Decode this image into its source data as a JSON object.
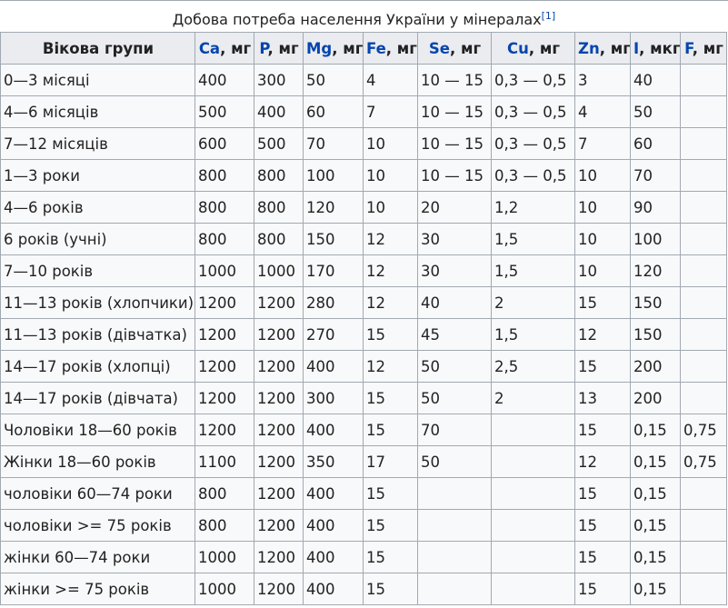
{
  "caption": {
    "text": "Добова потреба населення України у мінералах",
    "ref": "[1]"
  },
  "headers": [
    {
      "name": "Вікова групи",
      "link": false
    },
    {
      "name": "Ca",
      "unit": ", мг",
      "link": true
    },
    {
      "name": "P",
      "unit": ", мг",
      "link": true
    },
    {
      "name": "Mg",
      "unit": ", мг",
      "link": true
    },
    {
      "name": "Fe",
      "unit": ", мг",
      "link": true
    },
    {
      "name": "Se",
      "unit": ", мг",
      "link": true
    },
    {
      "name": "Cu",
      "unit": ", мг",
      "link": true
    },
    {
      "name": "Zn",
      "unit": ", мг",
      "link": true
    },
    {
      "name": "I",
      "unit": ", мкг",
      "link": true
    },
    {
      "name": "F",
      "unit": ", мг",
      "link": true
    }
  ],
  "rows": [
    [
      "0—3 місяці",
      "400",
      "300",
      "50",
      "4",
      "10 — 15",
      "0,3 — 0,5",
      "3",
      "40",
      ""
    ],
    [
      "4—6 місяців",
      "500",
      "400",
      "60",
      "7",
      "10 — 15",
      "0,3 — 0,5",
      "4",
      "50",
      ""
    ],
    [
      "7—12 місяців",
      "600",
      "500",
      "70",
      "10",
      "10 — 15",
      "0,3 — 0,5",
      "7",
      "60",
      ""
    ],
    [
      "1—3 роки",
      "800",
      "800",
      "100",
      "10",
      "10 — 15",
      "0,3 — 0,5",
      "10",
      "70",
      ""
    ],
    [
      "4—6 років",
      "800",
      "800",
      "120",
      "10",
      "20",
      "1,2",
      "10",
      "90",
      ""
    ],
    [
      "6 років (учні)",
      "800",
      "800",
      "150",
      "12",
      "30",
      "1,5",
      "10",
      "100",
      ""
    ],
    [
      "7—10 років",
      "1000",
      "1000",
      "170",
      "12",
      "30",
      "1,5",
      "10",
      "120",
      ""
    ],
    [
      "11—13 років (хлопчики)",
      "1200",
      "1200",
      "280",
      "12",
      "40",
      "2",
      "15",
      "150",
      ""
    ],
    [
      "11—13 років (дівчатка)",
      "1200",
      "1200",
      "270",
      "15",
      "45",
      "1,5",
      "12",
      "150",
      ""
    ],
    [
      "14—17 років (хлопці)",
      "1200",
      "1200",
      "400",
      "12",
      "50",
      "2,5",
      "15",
      "200",
      ""
    ],
    [
      "14—17 років (дівчата)",
      "1200",
      "1200",
      "300",
      "15",
      "50",
      "2",
      "13",
      "200",
      ""
    ],
    [
      "Чоловіки 18—60 років",
      "1200",
      "1200",
      "400",
      "15",
      "70",
      "",
      "15",
      "0,15",
      "0,75"
    ],
    [
      "Жінки 18—60 років",
      "1100",
      "1200",
      "350",
      "17",
      "50",
      "",
      "12",
      "0,15",
      "0,75"
    ],
    [
      "чоловіки 60—74 роки",
      "800",
      "1200",
      "400",
      "15",
      "",
      "",
      "15",
      "0,15",
      ""
    ],
    [
      "чоловіки >= 75 років",
      "800",
      "1200",
      "400",
      "15",
      "",
      "",
      "15",
      "0,15",
      ""
    ],
    [
      "жінки 60—74 роки",
      "1000",
      "1200",
      "400",
      "15",
      "",
      "",
      "15",
      "0,15",
      ""
    ],
    [
      "жінки >= 75 років",
      "1000",
      "1200",
      "400",
      "15",
      "",
      "",
      "15",
      "0,15",
      ""
    ]
  ]
}
